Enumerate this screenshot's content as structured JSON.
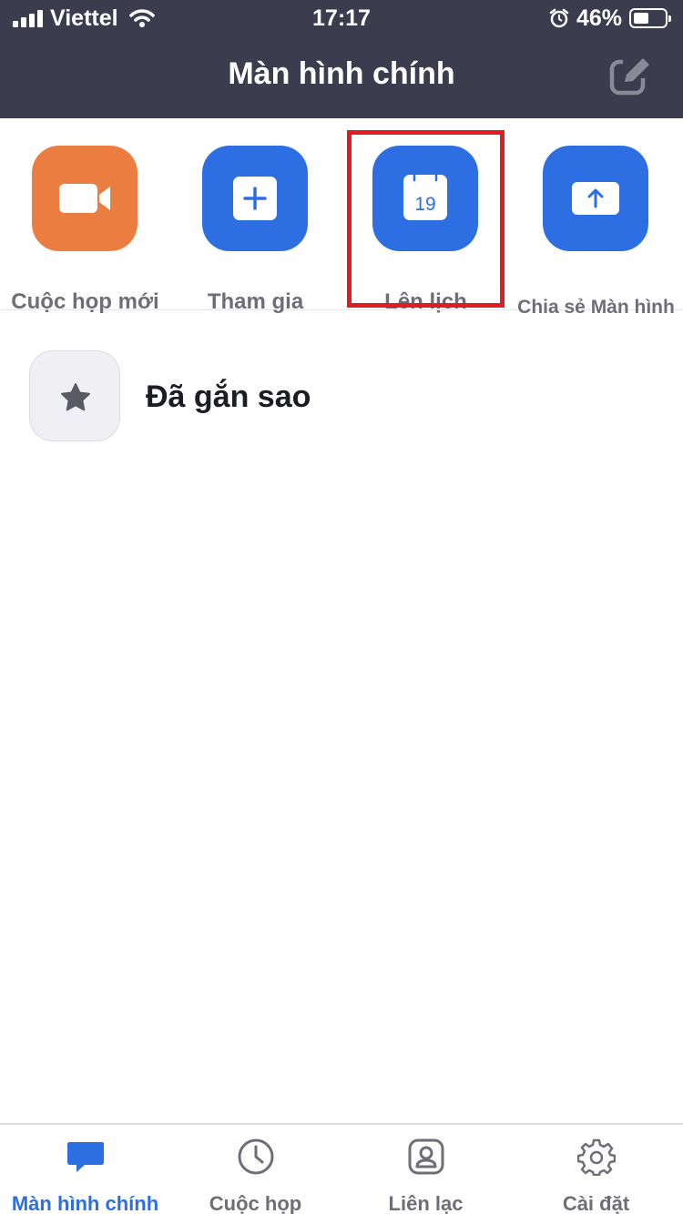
{
  "status_bar": {
    "carrier": "Viettel",
    "time": "17:17",
    "battery_percent": "46%",
    "battery_level": 0.46
  },
  "header": {
    "title": "Màn hình chính",
    "edit_icon": "compose-icon"
  },
  "actions": [
    {
      "label": "Cuộc họp mới",
      "icon": "video-camera-icon",
      "color": "#ec7d40"
    },
    {
      "label": "Tham gia",
      "icon": "plus-icon",
      "color": "#2d6fe3"
    },
    {
      "label": "Lên lịch",
      "icon": "calendar-icon",
      "calendar_day": "19",
      "color": "#2d6fe3"
    },
    {
      "label": "Chia sẻ Màn hình",
      "icon": "share-screen-icon",
      "color": "#2d6fe3"
    }
  ],
  "starred": {
    "label": "Đã gắn sao",
    "icon": "star-icon"
  },
  "tabbar": {
    "tabs": [
      {
        "label": "Màn hình chính",
        "icon": "chat-bubble-icon",
        "active": true
      },
      {
        "label": "Cuộc họp",
        "icon": "clock-icon",
        "active": false
      },
      {
        "label": "Liên lạc",
        "icon": "contact-icon",
        "active": false
      },
      {
        "label": "Cài đặt",
        "icon": "gear-icon",
        "active": false
      }
    ]
  },
  "colors": {
    "header_bg": "#3b3c4d",
    "accent": "#2d6fe3",
    "orange": "#ec7d40",
    "highlight": "#e31b23"
  }
}
